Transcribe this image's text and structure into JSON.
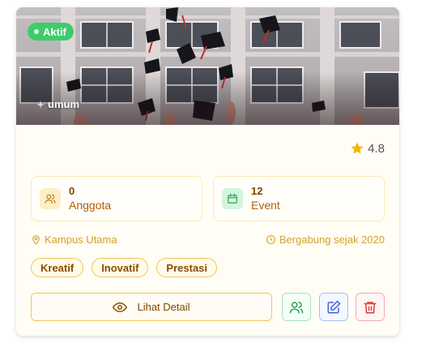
{
  "card": {
    "status_badge": "Aktif",
    "category": "umum",
    "rating": "4.8",
    "stats": [
      {
        "value": "0",
        "label": "Anggota",
        "icon": "users-icon"
      },
      {
        "value": "12",
        "label": "Event",
        "icon": "calendar-icon"
      }
    ],
    "location": "Kampus Utama",
    "joined": "Bergabung sejak 2020",
    "tags": [
      "Kreatif",
      "Inovatif",
      "Prestasi"
    ],
    "actions": {
      "detail_label": "Lihat Detail",
      "members_icon": "users-icon",
      "edit_icon": "edit-icon",
      "delete_icon": "trash-icon"
    },
    "colors": {
      "accent": "#f5c654",
      "active_badge": "#3fcb6b",
      "star": "#f5b50a",
      "delete": "#e03a3a",
      "edit": "#3d63dd",
      "members": "#2e9e4f"
    }
  }
}
